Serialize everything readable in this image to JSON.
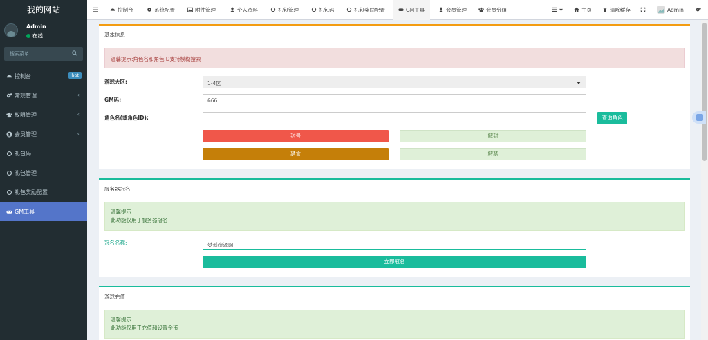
{
  "sidebar": {
    "site_title": "我的网站",
    "user": {
      "name": "Admin",
      "status": "在线"
    },
    "search_placeholder": "搜索菜单",
    "items": [
      {
        "label": "控制台",
        "badge": "hot",
        "icon": "dashboard-icon"
      },
      {
        "label": "常规管理",
        "chevron": "‹",
        "icon": "cogs-icon"
      },
      {
        "label": "权限管理",
        "chevron": "‹",
        "icon": "group-icon"
      },
      {
        "label": "会员管理",
        "chevron": "‹",
        "icon": "user-circle-icon"
      },
      {
        "label": "礼包码",
        "icon": "circle-icon"
      },
      {
        "label": "礼包管理",
        "icon": "circle-icon"
      },
      {
        "label": "礼包奖励配置",
        "icon": "circle-icon"
      },
      {
        "label": "GM工具",
        "icon": "gamepad-icon",
        "active": true
      }
    ]
  },
  "navbar": {
    "tabs": [
      "控制台",
      "系统配置",
      "附件管理",
      "个人资料",
      "礼包管理",
      "礼包码",
      "礼包奖励配置",
      "GM工具",
      "会员管理",
      "会员分组"
    ],
    "right": {
      "home": "主页",
      "clear_cache": "清除缓存",
      "user": "Admin"
    }
  },
  "basic": {
    "title": "基本信息",
    "alert": "温馨提示:角色名和角色ID支持模糊搜索",
    "server_label": "游戏大区:",
    "server_value": "1-4区",
    "gm_label": "GM码:",
    "gm_value": "666",
    "role_label": "角色名(或角色ID):",
    "role_value": "",
    "query_button": "查询角色",
    "ban_button": "封号",
    "unban_button": "解封",
    "mute_button": "禁言",
    "unmute_button": "解禁"
  },
  "naming": {
    "title": "服务器冠名",
    "alert_title": "温馨提示",
    "alert_text": "此功能仅用于服务器冠名",
    "name_label": "冠名名称:",
    "name_value": "梦遥资源网",
    "submit_button": "立即冠名"
  },
  "recharge": {
    "title": "游戏充值",
    "alert_title": "温馨提示",
    "alert_text": "此功能仅用于充值和设置金币"
  },
  "colors": {
    "sidebar_bg": "#222d32",
    "active_menu": "#5475c9",
    "danger": "#f0574a",
    "warning": "#c57f09",
    "teal": "#1abc9c"
  }
}
